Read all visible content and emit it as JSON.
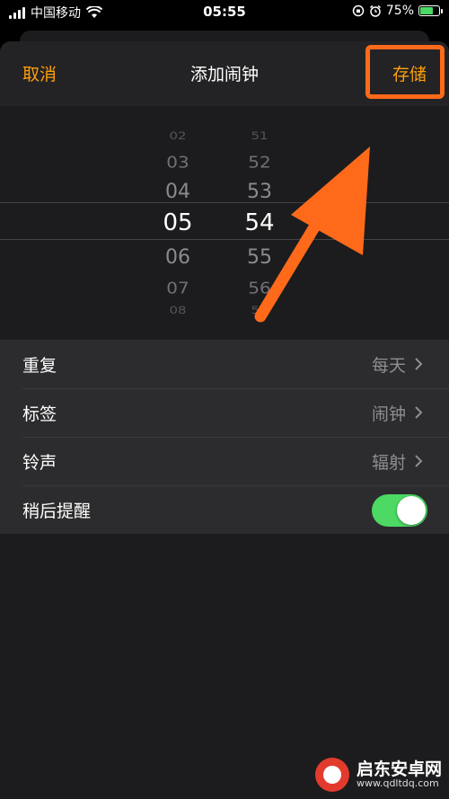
{
  "status": {
    "carrier": "中国移动",
    "time": "05:55",
    "battery": "75%",
    "battery_level": 0.75
  },
  "nav": {
    "cancel": "取消",
    "title": "添加闹钟",
    "save": "存储"
  },
  "picker": {
    "hours": [
      "02",
      "03",
      "04",
      "05",
      "06",
      "07",
      "08"
    ],
    "minutes": [
      "51",
      "52",
      "53",
      "54",
      "55",
      "56",
      "57"
    ],
    "selected_hour": "05",
    "selected_minute": "54"
  },
  "settings": {
    "repeat": {
      "label": "重复",
      "value": "每天"
    },
    "tag": {
      "label": "标签",
      "value": "闹钟"
    },
    "sound": {
      "label": "铃声",
      "value": "辐射"
    },
    "snooze": {
      "label": "稍后提醒",
      "on": true
    }
  },
  "watermark": {
    "name": "启东安卓网",
    "url": "www.qdltdq.com"
  },
  "colors": {
    "accent": "#ff9f0a",
    "annotation": "#ff6a1a",
    "toggle_on": "#4cd964"
  }
}
